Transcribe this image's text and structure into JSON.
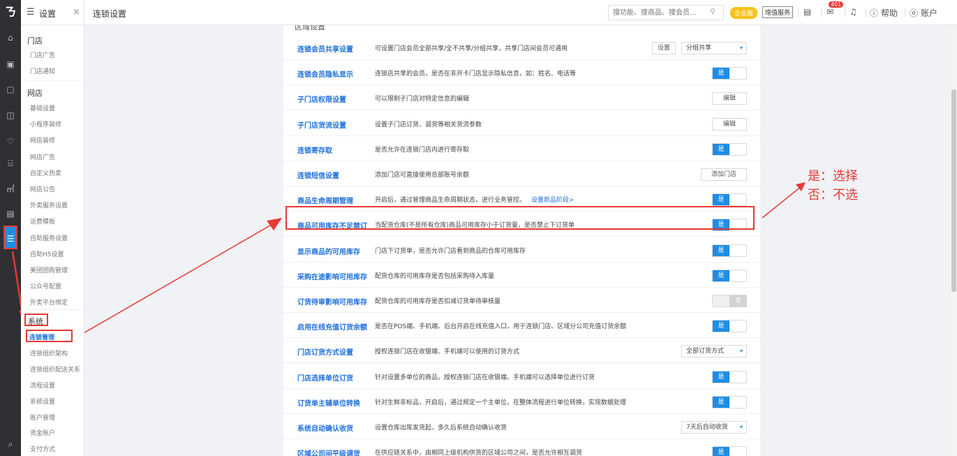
{
  "rail": {
    "logo": "〵",
    "icons": [
      "home-icon",
      "shop-icon",
      "screen-icon",
      "bag-icon",
      "heart-icon",
      "bank-icon",
      "chart-icon",
      "doc-icon",
      "settings-icon",
      "search-list-icon"
    ]
  },
  "sidebar": {
    "title": "设置",
    "close": "×",
    "store_section": "门店",
    "store_items": [
      "门店广告",
      "门店通知"
    ],
    "online_section": "网店",
    "online_items": [
      "基础设置",
      "小程序装修",
      "网店装修",
      "网店广告",
      "自定义热卖",
      "网店公告",
      "外卖服务设置",
      "运费模板",
      "自助服务设置",
      "自助H5设置",
      "美团团购管理",
      "公众号配置",
      "外卖平台绑定"
    ],
    "system_section": "系统",
    "system_items": [
      "连锁管理",
      "连锁组织架构",
      "连锁组织配送关系",
      "流程设置",
      "系统设置",
      "账户管理",
      "资金账户",
      "支付方式"
    ]
  },
  "topbar": {
    "breadcrumb": "连锁设置",
    "search_placeholder": "搜功能、搜商品、搜会员...",
    "enterprise_badge": "企业版",
    "value_added": "增值服务",
    "notif_count": "401",
    "help": "帮助",
    "account": "账户"
  },
  "panel": {
    "section_cut": "区域设置",
    "rows": [
      {
        "name": "连锁会员共享设置",
        "desc": "可设置门店会员全部共享/全不共享/分组共享，共享门店间会员可通用",
        "control": "button-select",
        "button": "设置",
        "select": "分组共享"
      },
      {
        "name": "连锁会员隐私显示",
        "desc": "连锁店共享的会员，是否在非开卡门店显示隐私信息，如：姓名、电话等",
        "control": "toggle",
        "value": "是"
      },
      {
        "name": "子门店权限设置",
        "desc": "可以限制子门店对特定信息的编辑",
        "control": "button",
        "button": "编辑"
      },
      {
        "name": "子门店货流设置",
        "desc": "设置子门店订货、调货等相关货流参数",
        "control": "button",
        "button": "编辑"
      },
      {
        "name": "连锁寄存取",
        "desc": "是否允许在连锁门店内进行寄存取",
        "control": "toggle",
        "value": "是"
      },
      {
        "name": "连锁短信设置",
        "desc": "添加门店可直接使用总部账号余额",
        "control": "button",
        "button": "添加门店"
      },
      {
        "name": "商品生命周期管理",
        "desc": "开启后，通过管理商品生命周期状态，进行业务管控。",
        "link": "设置新品阶段>",
        "control": "toggle",
        "value": "是"
      },
      {
        "name": "商品可用库存不足禁订",
        "desc": "当配货仓库(不是所有仓库)商品可用库存小于订货量，是否禁止下订货单",
        "control": "toggle",
        "value": "是"
      },
      {
        "name": "显示商品的可用库存",
        "desc": "门店下订货单，是否允许门店看到商品的仓库可用库存",
        "control": "toggle",
        "value": "是"
      },
      {
        "name": "采购在途影响可用库存",
        "desc": "配货仓库的可用库存是否包括采购待入库量",
        "control": "toggle",
        "value": "是"
      },
      {
        "name": "订货待审影响可用库存",
        "desc": "配货仓库的可用库存是否扣减订货单待审核量",
        "control": "toggle-off",
        "value": "否"
      },
      {
        "name": "启用在线充值订货余额",
        "desc": "是否在POS端、手机端、后台开启在线充值入口，用于连锁门店、区域分公司充值订货余额",
        "control": "toggle",
        "value": "是"
      },
      {
        "name": "门店订货方式设置",
        "desc": "授权连锁门店在收银端、手机端可以使用的订货方式",
        "control": "select",
        "select": "全部订货方式"
      },
      {
        "name": "门店选择单位订货",
        "desc": "针对设置多单位的商品，授权连锁门店在收银端、手机端可以选择单位进行订货",
        "control": "toggle",
        "value": "是"
      },
      {
        "name": "订货单主辅单位转换",
        "desc": "针对生鲜非标品，开启后，通过规定一个主单位，在整体流程进行单位转换，实现数据处理",
        "control": "toggle",
        "value": "是"
      },
      {
        "name": "系统自动确认收货",
        "desc": "设置仓库出库发货起，多久后系统自动确认收货",
        "control": "select",
        "select": "7天后自动收货"
      },
      {
        "name": "区域公司间平级调货",
        "desc": "在供应链关系中，由相同上级机构供货的区域公司之间，是否允许相互调货",
        "control": "toggle",
        "value": "是"
      }
    ]
  },
  "annotation": {
    "line1": "是：选择",
    "line2": "否：不选"
  },
  "colors": {
    "accent": "#1e8de6",
    "highlight": "#e53935",
    "link": "#1e6fd9"
  }
}
